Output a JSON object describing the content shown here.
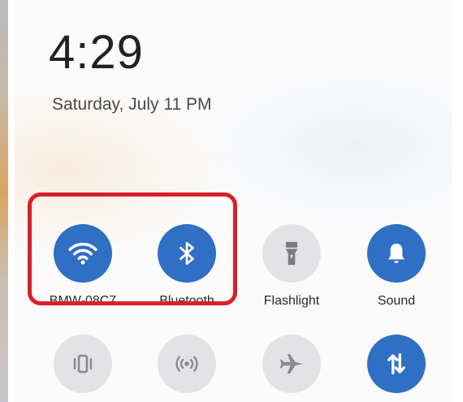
{
  "status": {
    "time": "4:29",
    "date": "Saturday, July 11  PM"
  },
  "quick_settings": {
    "row1": [
      {
        "label": "BMW-08C7",
        "icon": "wifi-icon",
        "state": "on"
      },
      {
        "label": "Bluetooth",
        "icon": "bluetooth-icon",
        "state": "on"
      },
      {
        "label": "Flashlight",
        "icon": "flashlight-icon",
        "state": "off"
      },
      {
        "label": "Sound",
        "icon": "bell-icon",
        "state": "on"
      }
    ],
    "row2": [
      {
        "icon": "vibrate-icon",
        "state": "off"
      },
      {
        "icon": "hotspot-icon",
        "state": "off"
      },
      {
        "icon": "airplane-icon",
        "state": "off"
      },
      {
        "icon": "mobile-data-icon",
        "state": "on"
      }
    ]
  },
  "colors": {
    "active": "#2f6fc4",
    "inactive": "#e3e3e5",
    "highlight": "#d8202a"
  }
}
